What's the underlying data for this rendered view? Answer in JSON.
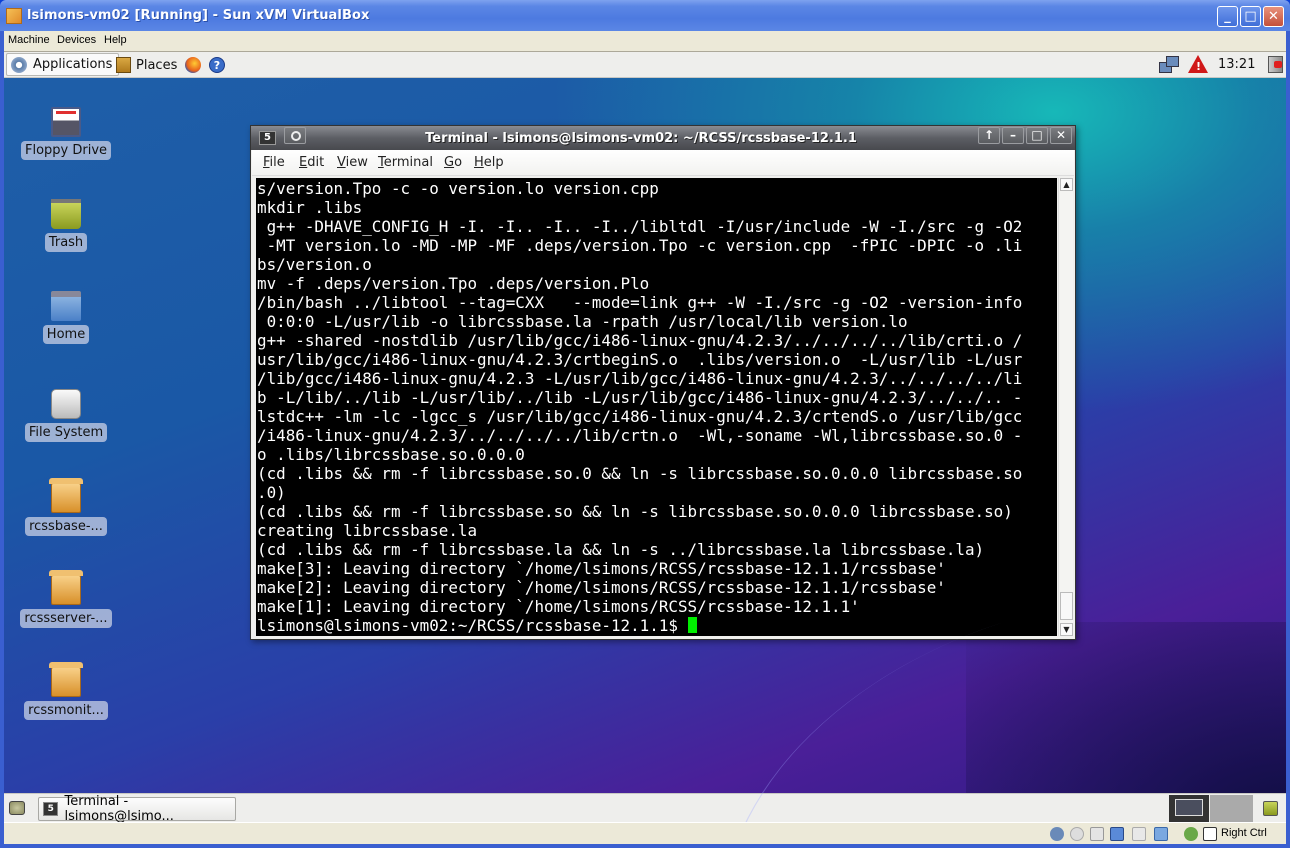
{
  "host_window": {
    "title": "lsimons-vm02 [Running] - Sun xVM VirtualBox",
    "menu": [
      "Machine",
      "Devices",
      "Help"
    ],
    "status_bar": {
      "host_key_label": "Right Ctrl",
      "icons": [
        "hard-disk-icon",
        "cd-dvd-icon",
        "floppy-icon",
        "network-icon",
        "usb-icon",
        "shared-folders-icon",
        "mouse-integration-icon",
        "host-key-icon"
      ]
    }
  },
  "guest": {
    "top_panel": {
      "applications_label": "Applications",
      "places_label": "Places",
      "clock": "13:21"
    },
    "desktop_icons": [
      {
        "label": "Floppy Drive",
        "icon": "floppy-drive-icon"
      },
      {
        "label": "Trash",
        "icon": "trash-icon"
      },
      {
        "label": "Home",
        "icon": "home-folder-icon"
      },
      {
        "label": "File System",
        "icon": "hard-drive-icon"
      },
      {
        "label": "rcssbase-...",
        "icon": "package-icon"
      },
      {
        "label": "rcssserver-...",
        "icon": "package-icon"
      },
      {
        "label": "rcssmonit...",
        "icon": "package-icon"
      }
    ],
    "bottom_panel": {
      "task_label": "Terminal - lsimons@lsimo..."
    }
  },
  "terminal": {
    "title": "Terminal - lsimons@lsimons-vm02: ~/RCSS/rcssbase-12.1.1",
    "menu": [
      "File",
      "Edit",
      "View",
      "Terminal",
      "Go",
      "Help"
    ],
    "lines": [
      "s/version.Tpo -c -o version.lo version.cpp",
      "mkdir .libs",
      " g++ -DHAVE_CONFIG_H -I. -I.. -I.. -I../libltdl -I/usr/include -W -I./src -g -O2",
      " -MT version.lo -MD -MP -MF .deps/version.Tpo -c version.cpp  -fPIC -DPIC -o .li",
      "bs/version.o",
      "mv -f .deps/version.Tpo .deps/version.Plo",
      "/bin/bash ../libtool --tag=CXX   --mode=link g++ -W -I./src -g -O2 -version-info",
      " 0:0:0 -L/usr/lib -o librcssbase.la -rpath /usr/local/lib version.lo",
      "g++ -shared -nostdlib /usr/lib/gcc/i486-linux-gnu/4.2.3/../../../../lib/crti.o /",
      "usr/lib/gcc/i486-linux-gnu/4.2.3/crtbeginS.o  .libs/version.o  -L/usr/lib -L/usr",
      "/lib/gcc/i486-linux-gnu/4.2.3 -L/usr/lib/gcc/i486-linux-gnu/4.2.3/../../../../li",
      "b -L/lib/../lib -L/usr/lib/../lib -L/usr/lib/gcc/i486-linux-gnu/4.2.3/../../.. -",
      "lstdc++ -lm -lc -lgcc_s /usr/lib/gcc/i486-linux-gnu/4.2.3/crtendS.o /usr/lib/gcc",
      "/i486-linux-gnu/4.2.3/../../../../lib/crtn.o  -Wl,-soname -Wl,librcssbase.so.0 -",
      "o .libs/librcssbase.so.0.0.0",
      "(cd .libs && rm -f librcssbase.so.0 && ln -s librcssbase.so.0.0.0 librcssbase.so",
      ".0)",
      "(cd .libs && rm -f librcssbase.so && ln -s librcssbase.so.0.0.0 librcssbase.so)",
      "creating librcssbase.la",
      "(cd .libs && rm -f librcssbase.la && ln -s ../librcssbase.la librcssbase.la)",
      "make[3]: Leaving directory `/home/lsimons/RCSS/rcssbase-12.1.1/rcssbase'",
      "make[2]: Leaving directory `/home/lsimons/RCSS/rcssbase-12.1.1/rcssbase'",
      "make[1]: Leaving directory `/home/lsimons/RCSS/rcssbase-12.1.1'"
    ],
    "prompt": "lsimons@lsimons-vm02:~/RCSS/rcssbase-12.1.1$ ",
    "cursor_color": "#00ee00"
  }
}
